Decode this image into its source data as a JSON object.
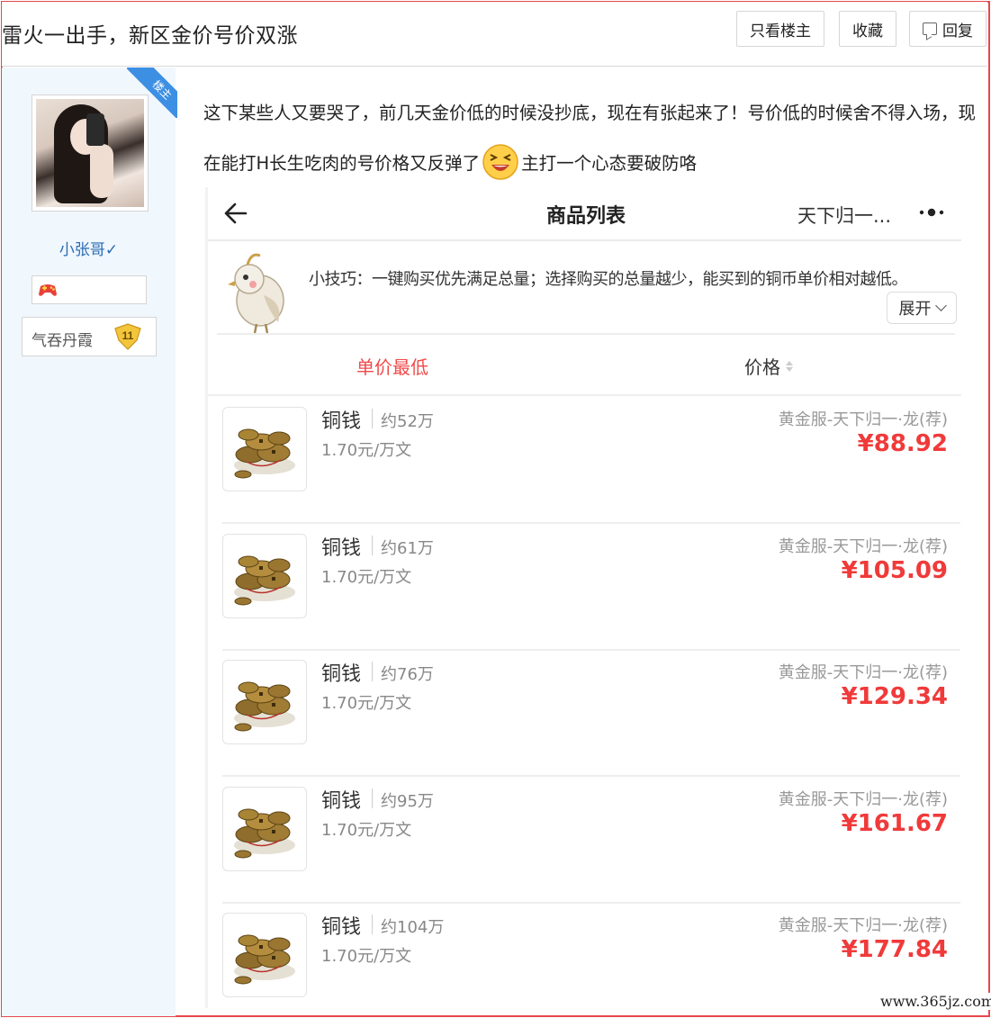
{
  "header": {
    "title": "雷火一出手，新区金价号价双涨",
    "only_host_label": "只看楼主",
    "favorite_label": "收藏",
    "reply_label": "回复"
  },
  "sidebar": {
    "host_tag": "楼主",
    "username": "小张哥✓",
    "level_name": "气吞丹霞",
    "level_number": "11"
  },
  "post": {
    "text_before_emoji": "这下某些人又要哭了，前几天金价低的时候没抄底，现在有张起来了！号价低的时候舍不得入场，现在能打H长生吃肉的号价格又反弹了",
    "text_after_emoji": "主打一个心态要破防咯"
  },
  "screenshot": {
    "nav_title": "商品列表",
    "nav_server": "天下归一...",
    "tip": "小技巧：一键购买优先满足总量；选择购买的总量越少，能买到的铜币单价相对越低。",
    "expand_label": "展开",
    "sort_lowest_label": "单价最低",
    "sort_price_label": "价格",
    "items": [
      {
        "name": "铜钱",
        "qty": "约52万",
        "unit_price": "1.70元/万文",
        "server": "黄金服-天下归一·龙(荐)",
        "price": "¥88.92"
      },
      {
        "name": "铜钱",
        "qty": "约61万",
        "unit_price": "1.70元/万文",
        "server": "黄金服-天下归一·龙(荐)",
        "price": "¥105.09"
      },
      {
        "name": "铜钱",
        "qty": "约76万",
        "unit_price": "1.70元/万文",
        "server": "黄金服-天下归一·龙(荐)",
        "price": "¥129.34"
      },
      {
        "name": "铜钱",
        "qty": "约95万",
        "unit_price": "1.70元/万文",
        "server": "黄金服-天下归一·龙(荐)",
        "price": "¥161.67"
      },
      {
        "name": "铜钱",
        "qty": "约104万",
        "unit_price": "1.70元/万文",
        "server": "黄金服-天下归一·龙(荐)",
        "price": "¥177.84"
      }
    ]
  },
  "watermark": "www.365jz.com",
  "colors": {
    "frame_border": "#e8474c",
    "sidebar_bg": "#f0f7fd",
    "username": "#2a6bb5",
    "host_tag_bg": "#3d8fe3",
    "price_red": "#f03a3a",
    "sort_active": "#f04a4a"
  },
  "icons": {
    "reply": "comment-icon",
    "back": "back-arrow-icon",
    "more": "more-dots-icon",
    "expand": "chevron-down-icon",
    "sort": "sort-arrows-icon",
    "emoji": "laughing-emoji-icon",
    "medal": "game-controller-icon",
    "level_badge": "level-shield-icon",
    "bird": "bird-mascot-icon",
    "coins": "copper-coins-icon"
  }
}
